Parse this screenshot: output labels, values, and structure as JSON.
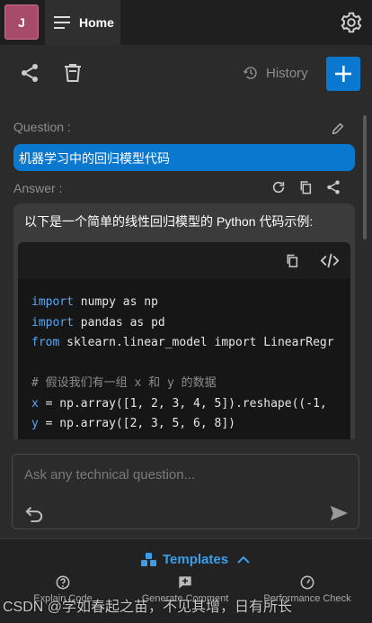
{
  "header": {
    "avatar_letter": "J",
    "home_label": "Home"
  },
  "toolbar": {
    "history_label": "History"
  },
  "question": {
    "label": "Question :",
    "text": "机器学习中的回归模型代码"
  },
  "answer": {
    "label": "Answer :",
    "intro": "以下是一个简单的线性回归模型的 Python 代码示例:",
    "code_lines": [
      "import numpy as np",
      "import pandas as pd",
      "from sklearn.linear_model import LinearRegr",
      "",
      "# 假设我们有一组 x 和 y 的数据",
      "x = np.array([1, 2, 3, 4, 5]).reshape((-1,",
      "y = np.array([2, 3, 5, 6, 8])"
    ]
  },
  "input": {
    "placeholder": "Ask any technical question..."
  },
  "templates": {
    "label": "Templates",
    "items": [
      {
        "label": "Explain Code",
        "icon": "help-circle-icon"
      },
      {
        "label": "Generate Comment",
        "icon": "comment-plus-icon"
      },
      {
        "label": "Performance Check",
        "icon": "gauge-icon"
      }
    ]
  },
  "watermark": "CSDN @学如春起之苗，不见其增，日有所长",
  "colors": {
    "accent": "#0b78d0",
    "templates": "#3b9eea",
    "avatar": "#a84a6a"
  }
}
